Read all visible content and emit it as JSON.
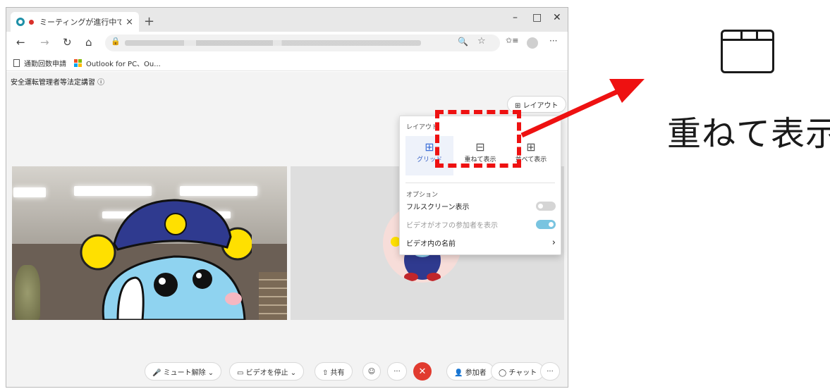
{
  "browser": {
    "tab_title": "ミーティングが進行中です...",
    "tab_close": "×",
    "new_tab": "+",
    "window_controls": {
      "minimize": "–",
      "maximize": "□",
      "close": "✕"
    },
    "nav": {
      "back": "←",
      "forward": "→",
      "reload": "↻",
      "home": "⌂",
      "lock": "🔒",
      "zoom": "🔍",
      "star": "☆",
      "favorites": "✩≡",
      "more": "···"
    },
    "favorites": [
      {
        "label": "通勤回数申請",
        "icon": "document-icon"
      },
      {
        "label": "Outlook for PC、Ou...",
        "icon": "microsoft-icon"
      }
    ]
  },
  "meeting": {
    "title": "安全運転管理者等法定講習 ⓘ",
    "layout_button": "⊞ レイアウト"
  },
  "layout_menu": {
    "header": "レイアウト",
    "options": [
      {
        "label": "グリッド",
        "icon": "grid-icon",
        "glyph": "⊞",
        "selected": true
      },
      {
        "label": "重ねて表示",
        "icon": "stacked-layout-icon",
        "glyph": "⊟",
        "selected": false
      },
      {
        "label": "並べて表示",
        "icon": "side-by-side-icon",
        "glyph": "⊞",
        "selected": false
      }
    ],
    "options_header": "オプション",
    "rows": [
      {
        "label": "フルスクリーン表示",
        "toggle": false
      },
      {
        "label": "ビデオがオフの参加者を表示",
        "toggle": true
      },
      {
        "label": "ビデオ内の名前",
        "chevron": "›"
      }
    ]
  },
  "controls": {
    "unmute": "🎤 ミュート解除 ⌄",
    "stop_video": "▭ ビデオを停止 ⌄",
    "share": "⇧ 共有",
    "reactions": "☺",
    "more": "···",
    "hangup": "✕",
    "participants": "👤 参加者",
    "chat": "◯ チャット",
    "overflow": "···"
  },
  "callout": {
    "label": "重ねて表示",
    "icon": "stacked-layout-icon",
    "arrow_color": "#ee1111",
    "highlight_color": "#ee1111"
  }
}
